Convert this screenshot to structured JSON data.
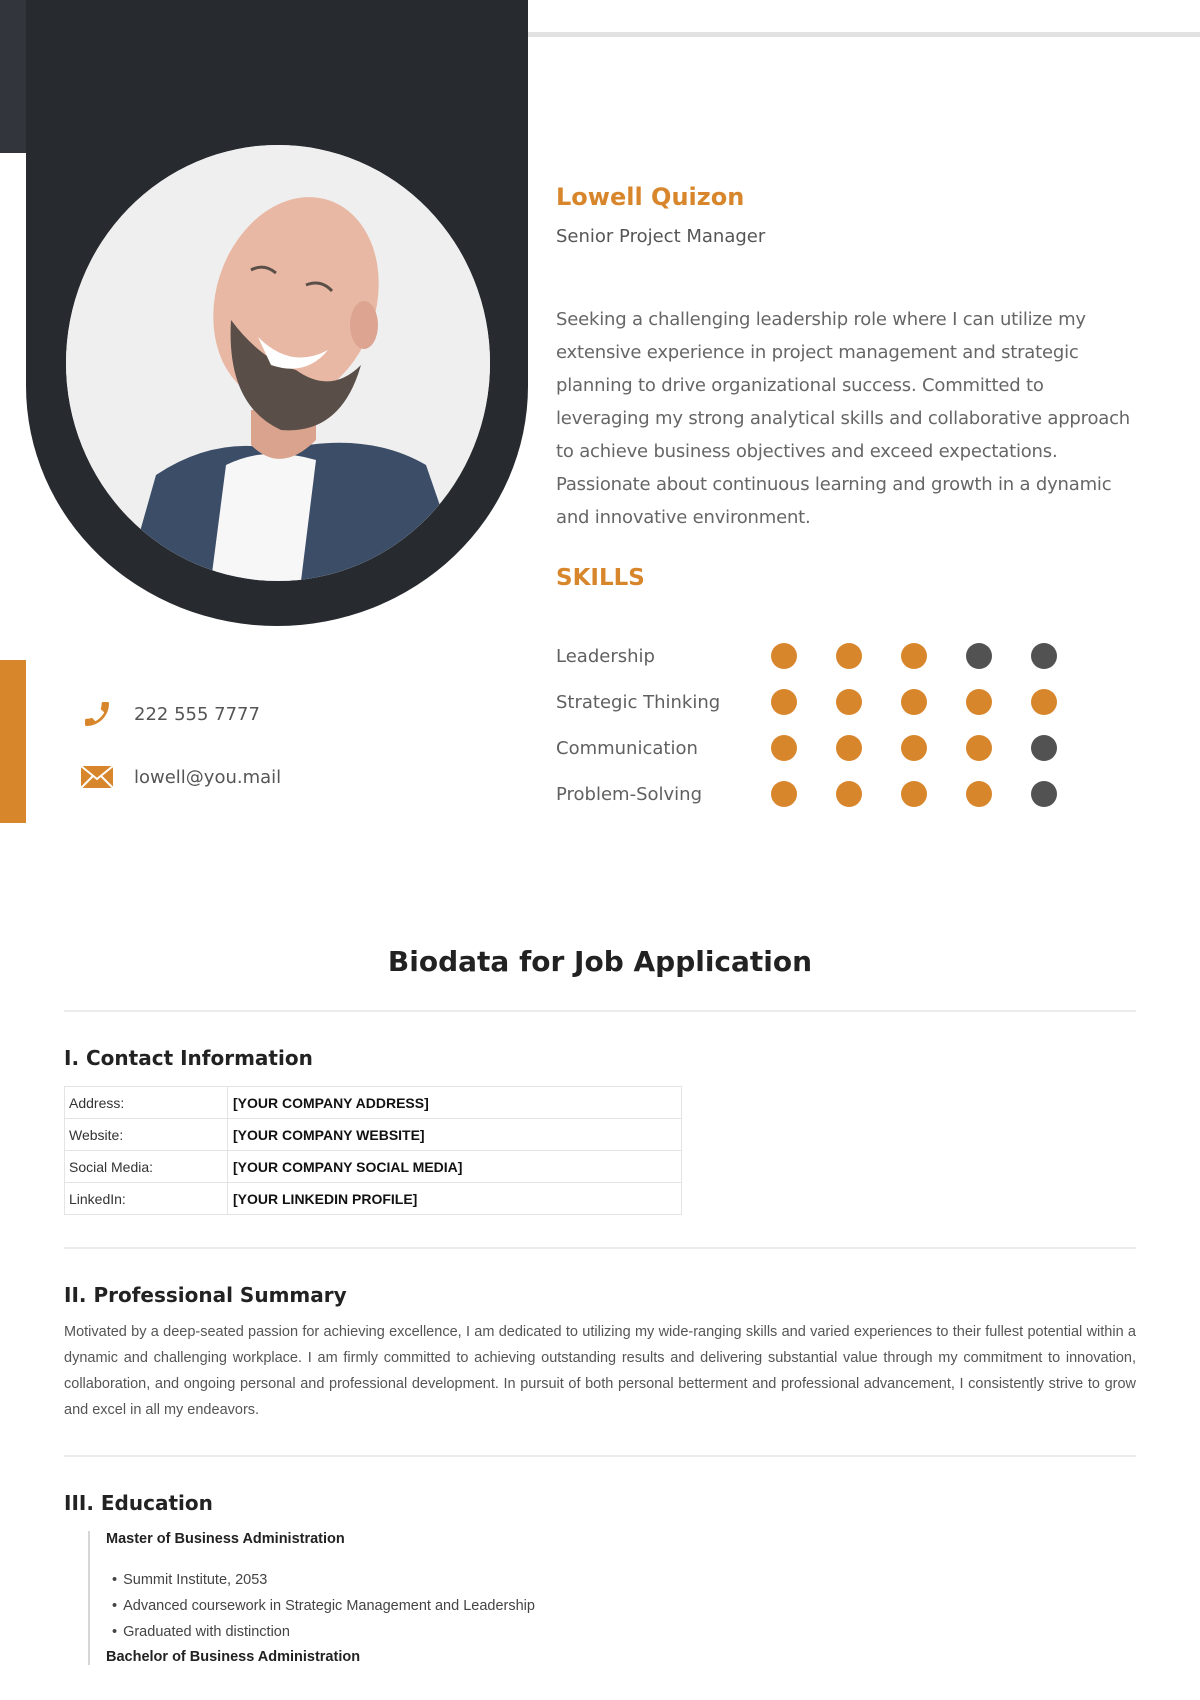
{
  "profile": {
    "name": "Lowell Quizon",
    "role": "Senior Project Manager",
    "objective": "Seeking a challenging leadership role where I can utilize my extensive experience in project management and strategic planning to drive organizational success. Committed to leveraging my strong analytical skills and collaborative approach to achieve business objectives and exceed expectations. Passionate about continuous learning and growth in a dynamic and innovative environment.",
    "photo_alt": "Portrait of a smiling bald bearded man in a navy blazer"
  },
  "contact": {
    "phone": "222 555 7777",
    "phone_icon": "phone-icon",
    "email": "lowell@you.mail",
    "email_icon": "envelope-icon"
  },
  "skills": {
    "title": "SKILLS",
    "max_rating": 5,
    "items": [
      {
        "label": "Leadership",
        "rating": 3
      },
      {
        "label": "Strategic Thinking",
        "rating": 5
      },
      {
        "label": "Communication",
        "rating": 4
      },
      {
        "label": "Problem-Solving",
        "rating": 4
      }
    ]
  },
  "colors": {
    "accent": "#d8862b",
    "dark": "#272a2f",
    "dot_off": "#525252"
  },
  "document": {
    "title": "Biodata for Job Application",
    "contact_section": {
      "title": "I. Contact Information",
      "rows": [
        {
          "key": "Address:",
          "value": "[YOUR COMPANY ADDRESS]"
        },
        {
          "key": "Website:",
          "value": "[YOUR COMPANY WEBSITE]"
        },
        {
          "key": "Social Media:",
          "value": "[YOUR COMPANY SOCIAL MEDIA]"
        },
        {
          "key": "LinkedIn:",
          "value": "[YOUR LINKEDIN PROFILE]"
        }
      ]
    },
    "summary_section": {
      "title": "II. Professional Summary",
      "text": "Motivated by a deep-seated passion for achieving excellence, I am dedicated to utilizing my wide-ranging skills and varied experiences to their fullest potential within a dynamic and challenging workplace. I am firmly committed to achieving outstanding results and delivering substantial value through my commitment to innovation, collaboration, and ongoing personal and professional development. In pursuit of both personal betterment and professional advancement, I consistently strive to grow and excel in all my endeavors."
    },
    "education_section": {
      "title": "III. Education",
      "degrees": [
        {
          "name": "Master of Business Administration",
          "bullets": [
            "Summit Institute, 2053",
            "Advanced coursework in Strategic Management and Leadership",
            "Graduated with distinction"
          ]
        },
        {
          "name": "Bachelor of Business Administration",
          "bullets": []
        }
      ]
    }
  }
}
